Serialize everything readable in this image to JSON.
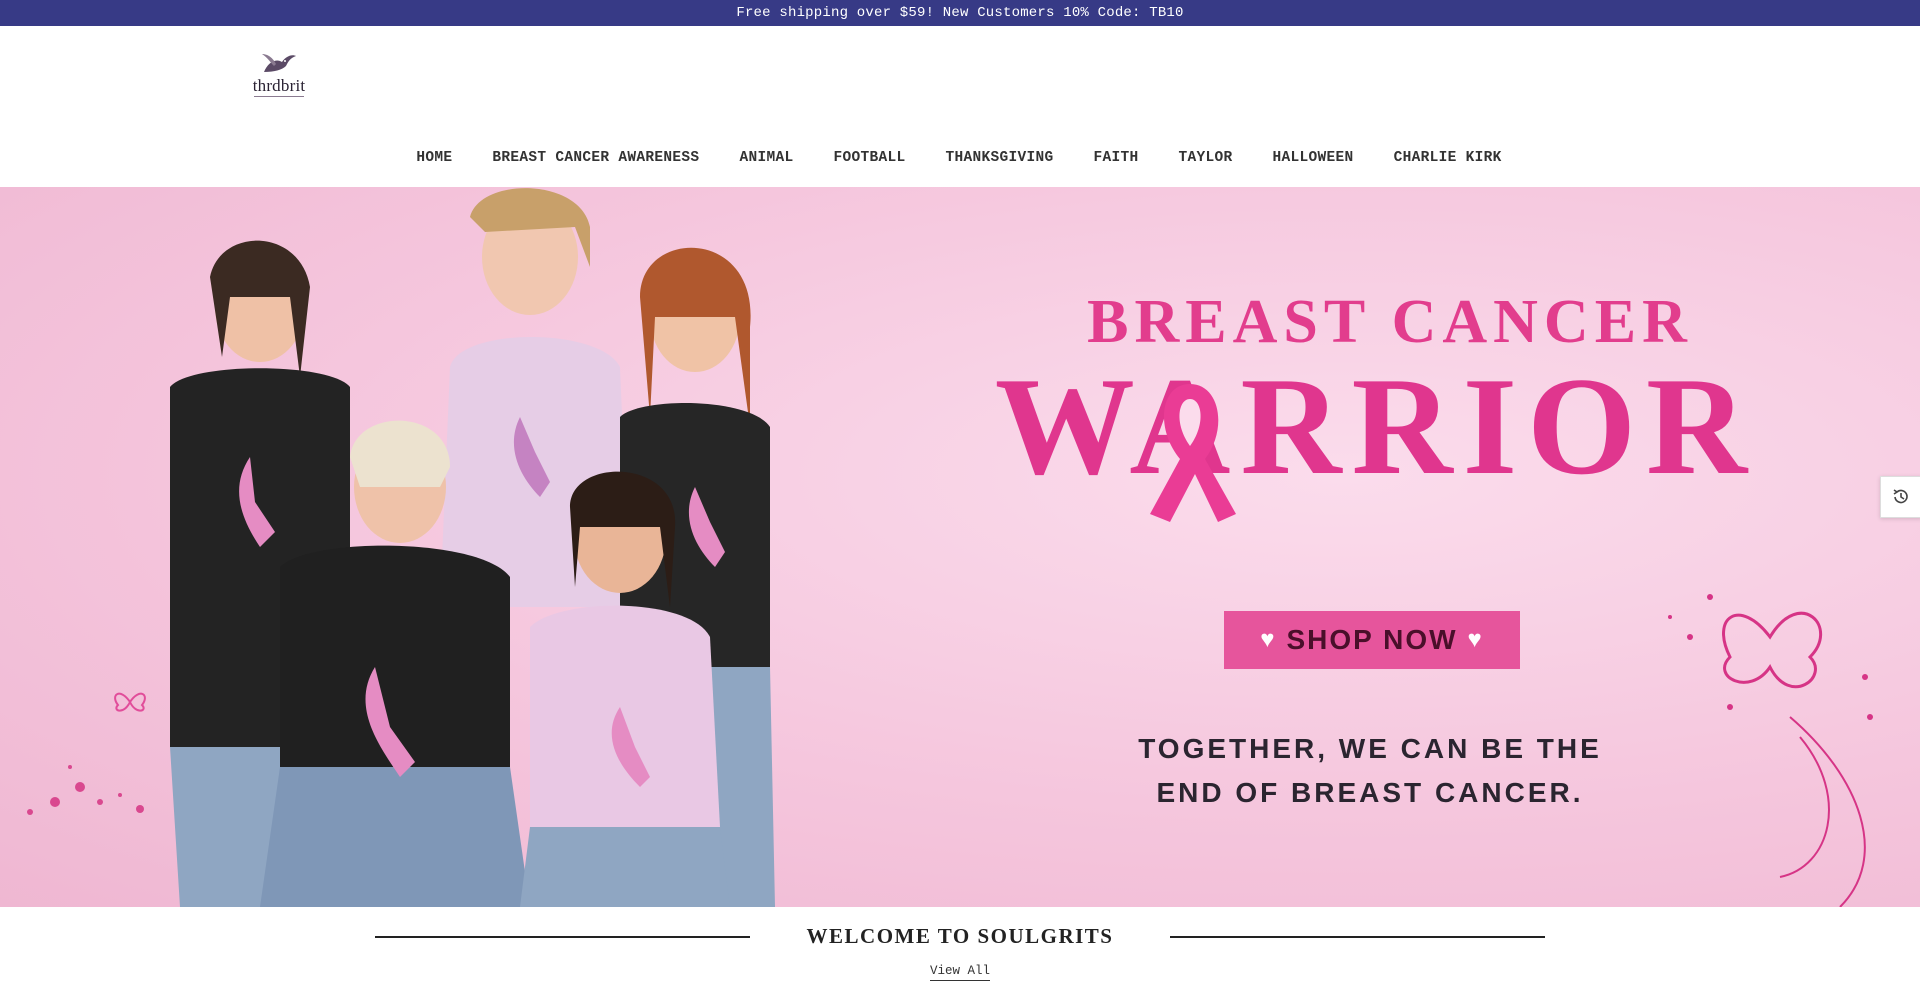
{
  "announcement": "Free shipping over $59! New Customers 10% Code: TB10",
  "brand": {
    "name": "thrdbrit"
  },
  "nav": [
    {
      "label": "HOME"
    },
    {
      "label": "BREAST CANCER AWARENESS"
    },
    {
      "label": "ANIMAL"
    },
    {
      "label": "FOOTBALL"
    },
    {
      "label": "THANKSGIVING"
    },
    {
      "label": "FAITH"
    },
    {
      "label": "TAYLOR"
    },
    {
      "label": "HALLOWEEN"
    },
    {
      "label": "CHARLIE KIRK"
    }
  ],
  "hero": {
    "title_line1": "BREAST CANCER",
    "title_line2": "WARRIOR",
    "shop_label": "SHOP NOW",
    "tagline_line1": "TOGETHER, WE CAN BE THE",
    "tagline_line2": "END OF BREAST CANCER.",
    "colors": {
      "pink": "#e0368e",
      "button": "#e6559c",
      "background": "#f5c6dd"
    }
  },
  "welcome": {
    "title": "WELCOME TO SOULGRITS",
    "view_all": "View All"
  },
  "icons": {
    "history": "history-icon",
    "heart": "heart-icon",
    "ribbon": "ribbon-icon"
  },
  "theme": {
    "announce_bg": "#373a86"
  }
}
